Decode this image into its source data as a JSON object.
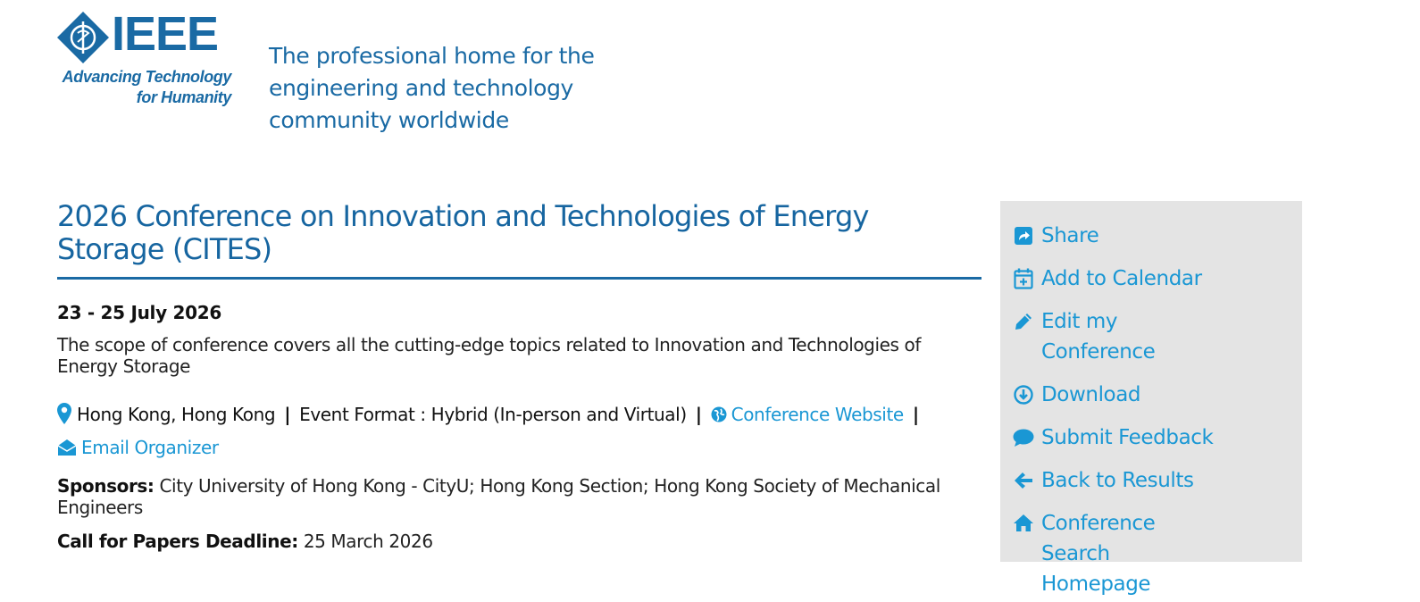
{
  "header": {
    "logo_text": "IEEE",
    "logo_subtext": "Advancing Technology for Humanity",
    "tagline": "The professional home for the engineering and technology community worldwide"
  },
  "conference": {
    "title": "2026 Conference on Innovation and Technologies of Energy Storage (CITES)",
    "dates": "23 - 25 July 2026",
    "scope": "The scope of conference covers all the cutting-edge topics related to Innovation and Technologies of Energy Storage",
    "location": "Hong Kong, Hong Kong",
    "event_format": "Event Format : Hybrid (In-person and Virtual)",
    "separator": "|",
    "website_label": "Conference Website",
    "email_label": "Email Organizer",
    "sponsors_label": "Sponsors:",
    "sponsors": "City University of Hong Kong - CityU; Hong Kong Section; Hong Kong Society of Mechanical Engineers",
    "cfp_label": "Call for Papers Deadline:",
    "cfp_date": "25 March 2026"
  },
  "sidebar": {
    "items": [
      {
        "label": "Share",
        "icon": "share-icon"
      },
      {
        "label": "Add to Calendar",
        "icon": "calendar-add-icon"
      },
      {
        "label": "Edit my Conference",
        "icon": "pencil-icon"
      },
      {
        "label": "Download",
        "icon": "download-icon"
      },
      {
        "label": "Submit Feedback",
        "icon": "comment-icon"
      },
      {
        "label": "Back to Results",
        "icon": "arrow-left-icon"
      },
      {
        "label": "Conference Search Homepage",
        "icon": "home-icon"
      }
    ]
  },
  "colors": {
    "brand_blue": "#1a6aa4",
    "link_blue": "#1a97d4",
    "sidebar_bg": "#e4e4e4"
  }
}
